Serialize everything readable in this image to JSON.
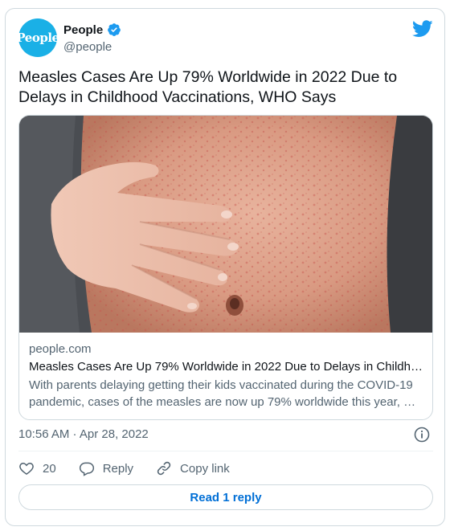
{
  "author": {
    "display_name": "People",
    "handle": "@people",
    "avatar_text": "People",
    "verified": true,
    "brand_color": "#1ab0e6"
  },
  "tweet": {
    "text": "Measles Cases Are Up 79% Worldwide in 2022 Due to Delays in Childhood Vaccinations, WHO Says",
    "timestamp": "10:56 AM · Apr 28, 2022"
  },
  "link_card": {
    "domain": "people.com",
    "title": "Measles Cases Are Up 79% Worldwide in 2022 Due to Delays in Childh…",
    "description": "With parents delaying getting their kids vaccinated during the COVID-19 pandemic, cases of the measles are now up 79% worldwide this year, …"
  },
  "actions": {
    "like_count": "20",
    "reply_label": "Reply",
    "copy_link_label": "Copy link"
  },
  "read_reply_label": "Read 1 reply",
  "icons": {
    "platform": "twitter-bird-icon",
    "verified": "verified-badge-icon",
    "info": "info-icon",
    "like": "heart-icon",
    "reply": "reply-bubble-icon",
    "copy": "link-icon"
  },
  "colors": {
    "accent": "#1d9bf0",
    "link_blue": "#006fd6",
    "secondary_text": "#536471",
    "border": "#cfd9de"
  }
}
